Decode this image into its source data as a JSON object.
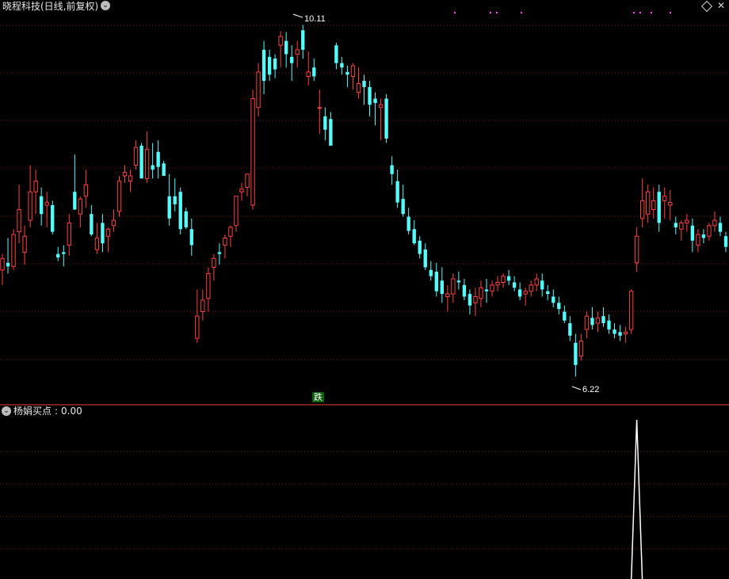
{
  "main_panel": {
    "title": "晓程科技(日线,前复权)",
    "signal_badge": "跌",
    "high_label": "10.11",
    "low_label": "6.22",
    "colors": {
      "up": "#ff4040",
      "down": "#54fcfc",
      "grid": "#7a1c1c",
      "divider": "#c03030",
      "marker": "#ff40ff"
    }
  },
  "sub_panel": {
    "indicator_name": "杨娟买点",
    "indicator_value": "0.00",
    "line_color": "#ffffff"
  },
  "chart_data": [
    {
      "type": "candlestick",
      "price_range": [
        6.0,
        10.3
      ],
      "high_annotation": 10.11,
      "low_annotation": 6.22,
      "grid": true,
      "candles": [
        [
          7.42,
          7.6,
          7.25,
          7.55
        ],
        [
          7.5,
          7.78,
          7.38,
          7.46
        ],
        [
          7.46,
          7.88,
          7.42,
          7.82
        ],
        [
          7.85,
          8.38,
          7.72,
          8.1
        ],
        [
          7.62,
          7.92,
          7.48,
          7.8
        ],
        [
          7.98,
          8.6,
          7.9,
          8.3
        ],
        [
          8.3,
          8.55,
          8.05,
          8.42
        ],
        [
          8.25,
          8.35,
          7.92,
          8.05
        ],
        [
          8.15,
          8.3,
          7.9,
          8.18
        ],
        [
          8.15,
          8.2,
          7.82,
          7.85
        ],
        [
          7.6,
          7.68,
          7.52,
          7.56
        ],
        [
          7.62,
          7.7,
          7.46,
          7.6
        ],
        [
          7.7,
          8.05,
          7.58,
          7.95
        ],
        [
          8.3,
          8.72,
          8.1,
          8.1
        ],
        [
          8.05,
          8.25,
          7.9,
          8.22
        ],
        [
          8.25,
          8.55,
          8.12,
          8.38
        ],
        [
          8.05,
          8.15,
          7.8,
          7.82
        ],
        [
          7.65,
          7.95,
          7.6,
          7.78
        ],
        [
          7.95,
          8.05,
          7.62,
          7.72
        ],
        [
          7.8,
          7.9,
          7.62,
          7.88
        ],
        [
          7.92,
          8.1,
          7.85,
          7.98
        ],
        [
          8.08,
          8.48,
          8.02,
          8.42
        ],
        [
          8.48,
          8.6,
          8.4,
          8.52
        ],
        [
          8.42,
          8.55,
          8.3,
          8.48
        ],
        [
          8.6,
          8.88,
          8.55,
          8.8
        ],
        [
          8.82,
          8.85,
          8.45,
          8.45
        ],
        [
          8.45,
          8.98,
          8.4,
          8.78
        ],
        [
          8.6,
          8.85,
          8.45,
          8.55
        ],
        [
          8.75,
          8.88,
          8.45,
          8.58
        ],
        [
          8.62,
          8.65,
          8.48,
          8.48
        ],
        [
          8.25,
          8.5,
          7.92,
          8.0
        ],
        [
          8.25,
          8.45,
          8.08,
          8.16
        ],
        [
          8.3,
          8.35,
          7.82,
          7.88
        ],
        [
          8.08,
          8.12,
          7.88,
          7.9
        ],
        [
          7.88,
          8.0,
          7.58,
          7.7
        ],
        [
          6.65,
          7.2,
          6.6,
          6.9
        ],
        [
          6.95,
          7.2,
          6.85,
          7.08
        ],
        [
          7.1,
          7.45,
          6.95,
          7.38
        ],
        [
          7.45,
          7.6,
          7.3,
          7.55
        ],
        [
          7.62,
          7.72,
          7.48,
          7.6
        ],
        [
          7.7,
          7.82,
          7.55,
          7.78
        ],
        [
          7.8,
          7.92,
          7.68,
          7.9
        ],
        [
          7.92,
          8.2,
          7.85,
          8.25
        ],
        [
          8.3,
          8.4,
          8.2,
          8.33
        ],
        [
          8.35,
          8.5,
          8.25,
          8.5
        ],
        [
          8.15,
          9.45,
          8.1,
          9.35
        ],
        [
          9.25,
          9.75,
          9.15,
          9.65
        ],
        [
          9.9,
          10.0,
          9.4,
          9.55
        ],
        [
          9.82,
          9.9,
          9.55,
          9.62
        ],
        [
          9.8,
          9.85,
          9.58,
          9.68
        ],
        [
          9.95,
          10.11,
          9.7,
          10.05
        ],
        [
          10.0,
          10.1,
          9.7,
          9.85
        ],
        [
          9.82,
          9.95,
          9.55,
          9.75
        ],
        [
          9.85,
          10.0,
          9.7,
          9.9
        ],
        [
          10.12,
          10.18,
          9.8,
          9.9
        ],
        [
          9.6,
          9.88,
          9.5,
          9.65
        ],
        [
          9.7,
          9.8,
          9.55,
          9.6
        ],
        [
          9.25,
          9.45,
          8.95,
          9.25
        ],
        [
          9.15,
          9.25,
          8.88,
          9.0
        ],
        [
          9.12,
          9.2,
          8.82,
          8.82
        ],
        [
          9.95,
          9.98,
          9.68,
          9.75
        ],
        [
          9.75,
          9.82,
          9.62,
          9.7
        ],
        [
          9.65,
          9.72,
          9.48,
          9.62
        ],
        [
          9.6,
          9.75,
          9.45,
          9.72
        ],
        [
          9.42,
          9.7,
          9.35,
          9.52
        ],
        [
          9.55,
          9.62,
          9.28,
          9.48
        ],
        [
          9.48,
          9.55,
          9.15,
          9.28
        ],
        [
          9.35,
          9.42,
          9.05,
          9.3
        ],
        [
          9.25,
          9.35,
          8.88,
          9.28
        ],
        [
          9.35,
          9.4,
          8.85,
          8.9
        ],
        [
          8.6,
          8.7,
          8.38,
          8.5
        ],
        [
          8.42,
          8.55,
          8.12,
          8.18
        ],
        [
          8.22,
          8.38,
          8.02,
          8.05
        ],
        [
          8.02,
          8.12,
          7.82,
          7.86
        ],
        [
          7.88,
          7.98,
          7.7,
          7.72
        ],
        [
          7.75,
          7.8,
          7.55,
          7.6
        ],
        [
          7.65,
          7.72,
          7.42,
          7.45
        ],
        [
          7.42,
          7.52,
          7.3,
          7.35
        ],
        [
          7.4,
          7.5,
          7.12,
          7.18
        ],
        [
          7.3,
          7.45,
          7.05,
          7.15
        ],
        [
          7.12,
          7.25,
          6.95,
          7.15
        ],
        [
          7.15,
          7.38,
          7.05,
          7.32
        ],
        [
          7.3,
          7.4,
          7.2,
          7.28
        ],
        [
          7.25,
          7.32,
          7.08,
          7.12
        ],
        [
          7.15,
          7.2,
          6.92,
          7.02
        ],
        [
          7.05,
          7.22,
          6.9,
          7.12
        ],
        [
          7.1,
          7.3,
          7.0,
          7.22
        ],
        [
          7.2,
          7.32,
          7.05,
          7.18
        ],
        [
          7.18,
          7.3,
          7.12,
          7.25
        ],
        [
          7.25,
          7.35,
          7.18,
          7.28
        ],
        [
          7.28,
          7.38,
          7.22,
          7.35
        ],
        [
          7.35,
          7.42,
          7.25,
          7.3
        ],
        [
          7.28,
          7.35,
          7.18,
          7.22
        ],
        [
          7.2,
          7.28,
          7.08,
          7.12
        ],
        [
          7.15,
          7.22,
          7.02,
          7.18
        ],
        [
          7.18,
          7.3,
          7.12,
          7.25
        ],
        [
          7.25,
          7.38,
          7.18,
          7.32
        ],
        [
          7.3,
          7.38,
          7.12,
          7.2
        ],
        [
          7.18,
          7.25,
          7.08,
          7.15
        ],
        [
          7.12,
          7.2,
          7.0,
          7.05
        ],
        [
          7.05,
          7.12,
          6.92,
          6.98
        ],
        [
          6.95,
          7.02,
          6.82,
          6.85
        ],
        [
          6.82,
          6.9,
          6.62,
          6.68
        ],
        [
          6.6,
          6.7,
          6.22,
          6.35
        ],
        [
          6.45,
          6.7,
          6.4,
          6.62
        ],
        [
          6.75,
          6.95,
          6.65,
          6.9
        ],
        [
          6.88,
          7.0,
          6.75,
          6.8
        ],
        [
          6.82,
          6.95,
          6.72,
          6.88
        ],
        [
          6.9,
          7.0,
          6.78,
          6.82
        ],
        [
          6.85,
          6.92,
          6.7,
          6.75
        ],
        [
          6.75,
          6.82,
          6.65,
          6.7
        ],
        [
          6.72,
          6.8,
          6.62,
          6.68
        ],
        [
          6.7,
          6.78,
          6.6,
          6.72
        ],
        [
          6.75,
          7.2,
          6.7,
          7.18
        ],
        [
          7.5,
          7.9,
          7.4,
          7.8
        ],
        [
          8.0,
          8.45,
          7.9,
          8.2
        ],
        [
          8.05,
          8.38,
          7.95,
          8.3
        ],
        [
          8.1,
          8.35,
          8.0,
          8.2
        ],
        [
          8.3,
          8.38,
          7.85,
          7.95
        ],
        [
          8.2,
          8.35,
          8.0,
          8.25
        ],
        [
          8.15,
          8.32,
          7.98,
          8.18
        ],
        [
          7.95,
          8.02,
          7.82,
          7.9
        ],
        [
          7.88,
          7.98,
          7.75,
          7.95
        ],
        [
          7.95,
          8.05,
          7.85,
          7.98
        ],
        [
          7.92,
          8.0,
          7.62,
          7.75
        ],
        [
          7.7,
          7.88,
          7.62,
          7.82
        ],
        [
          7.82,
          7.88,
          7.72,
          7.78
        ],
        [
          7.8,
          7.95,
          7.75,
          7.92
        ],
        [
          7.92,
          8.08,
          7.85,
          7.98
        ],
        [
          7.95,
          8.02,
          7.8,
          7.85
        ],
        [
          7.8,
          7.85,
          7.62,
          7.68
        ]
      ]
    },
    {
      "type": "line",
      "name": "杨娟买点",
      "y_range": [
        0,
        1
      ],
      "grid": true,
      "values": [
        0,
        0,
        0,
        0,
        0,
        0,
        0,
        0,
        0,
        0,
        0,
        0,
        0,
        0,
        0,
        0,
        0,
        0,
        0,
        0,
        0,
        0,
        0,
        0,
        0,
        0,
        0,
        0,
        0,
        0,
        0,
        0,
        0,
        0,
        0,
        0,
        0,
        0,
        0,
        0,
        0,
        0,
        0,
        0,
        0,
        0,
        0,
        0,
        0,
        0,
        0,
        0,
        0,
        0,
        0,
        0,
        0,
        0,
        0,
        0,
        0,
        0,
        0,
        0,
        0,
        0,
        0,
        0,
        0,
        0,
        0,
        0,
        0,
        0,
        0,
        0,
        0,
        0,
        0,
        0,
        0,
        0,
        0,
        0,
        0,
        0,
        0,
        0,
        0,
        0,
        0,
        0,
        0,
        0,
        0,
        0,
        0,
        0,
        0,
        0,
        0,
        0,
        0,
        0,
        0,
        0,
        0,
        0,
        0,
        0,
        0,
        0,
        0,
        0,
        1,
        0,
        0,
        0,
        0,
        0,
        0,
        0,
        0,
        0,
        0,
        0,
        0,
        0,
        0,
        0,
        0
      ]
    }
  ]
}
